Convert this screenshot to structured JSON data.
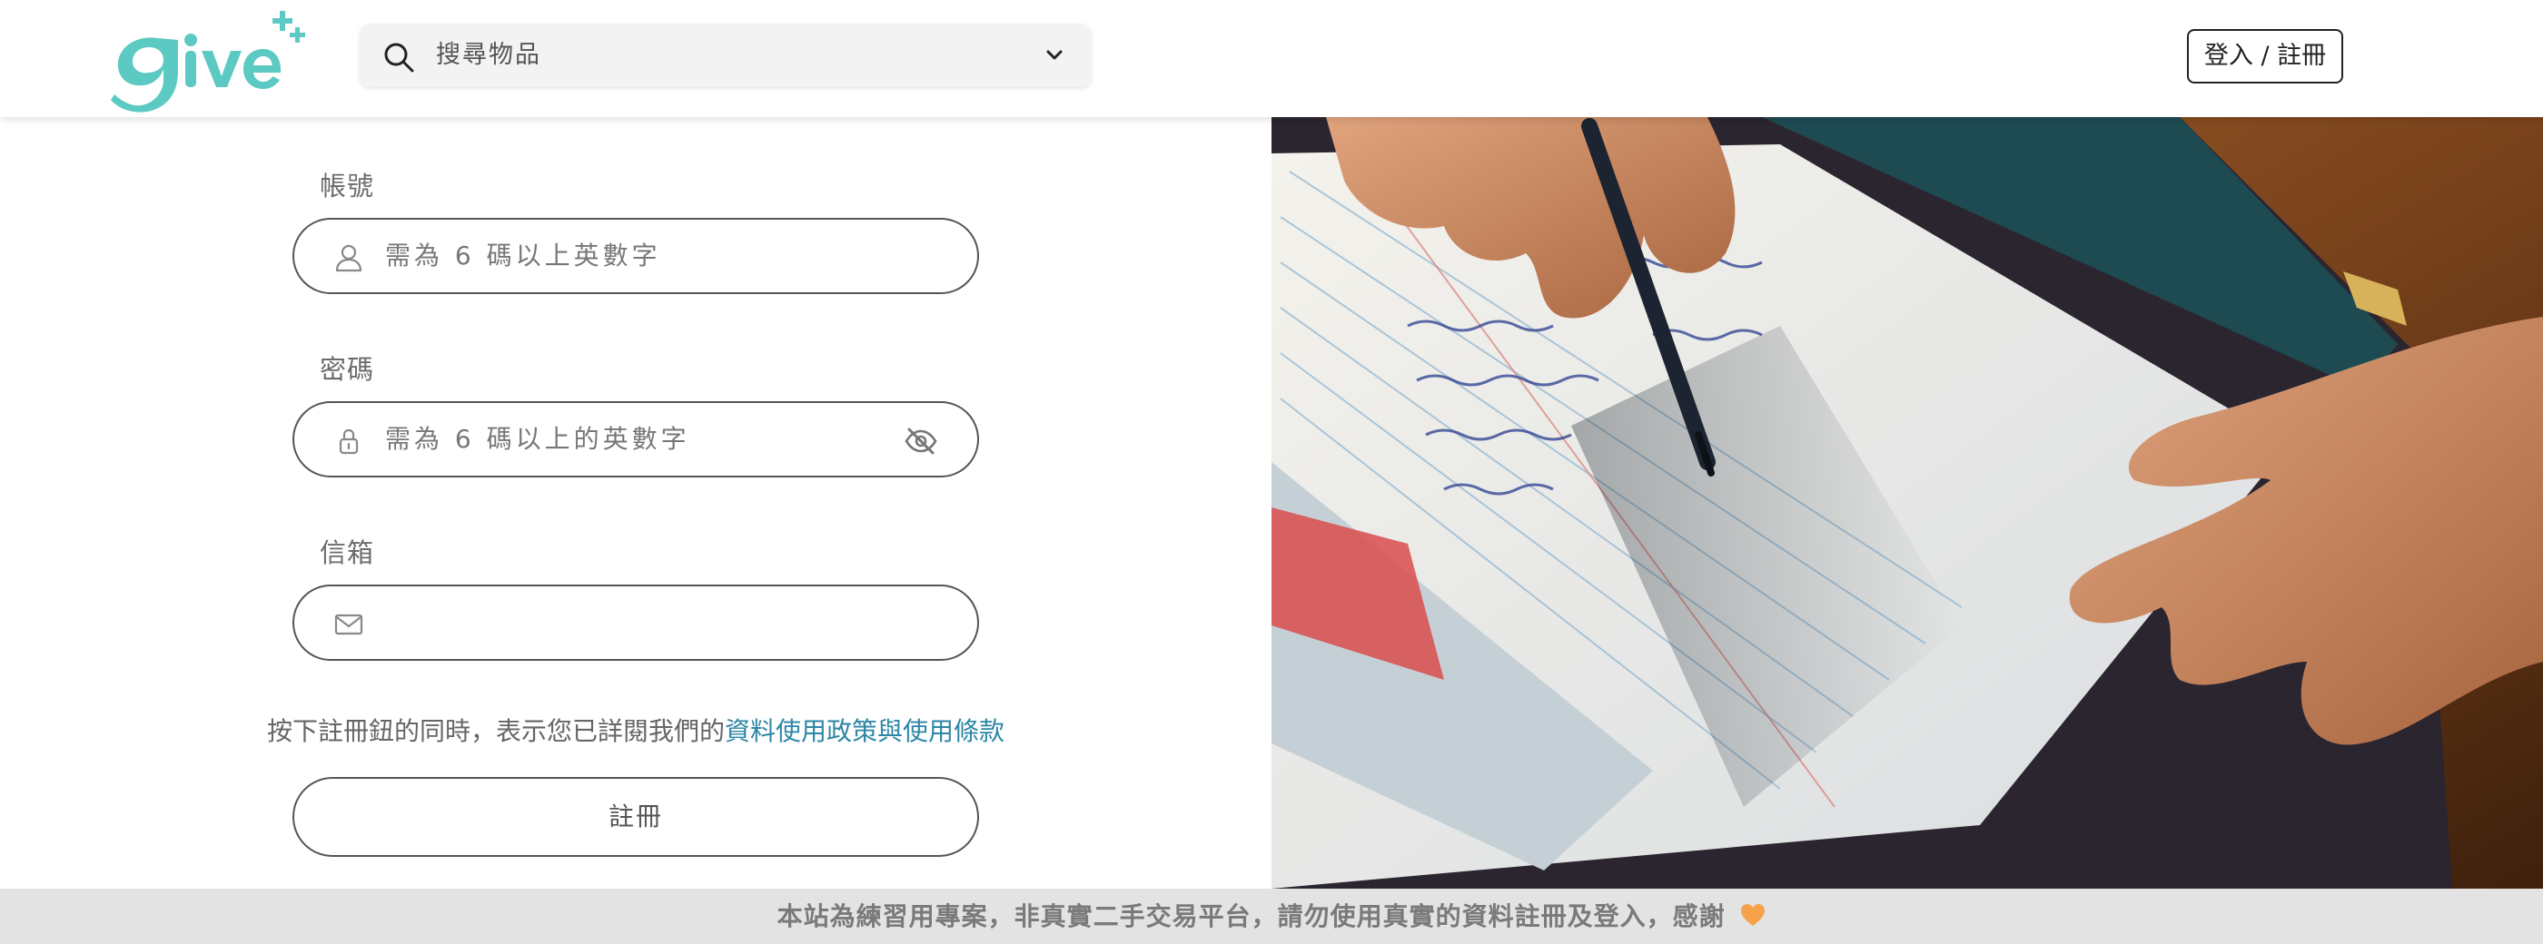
{
  "header": {
    "logo_text": "give+",
    "search": {
      "placeholder": "搜尋物品",
      "icon": "search-icon",
      "dropdown_icon": "chevron-down-icon"
    },
    "login_label": "登入 / 註冊"
  },
  "form": {
    "account": {
      "label": "帳號",
      "placeholder": "需為 6 碼以上英數字",
      "icon": "user-icon"
    },
    "password": {
      "label": "密碼",
      "placeholder": "需為 6 碼以上的英數字",
      "icon": "lock-icon",
      "toggle_icon": "eye-off-icon"
    },
    "email": {
      "label": "信箱",
      "placeholder": "",
      "icon": "mail-icon"
    },
    "terms_prefix": "按下註冊鈕的同時，表示您已詳閱我們的",
    "terms_link": "資料使用政策與使用條款",
    "register_label": "註冊"
  },
  "banner": {
    "text": "本站為練習用專案，非真實二手交易平台，請勿使用真實的資料註冊及登入，感謝",
    "icon": "orange-heart-icon"
  },
  "colors": {
    "brand_teal": "#5cc9c3",
    "link": "#2d86a6",
    "heart": "#f7a14a",
    "banner_bg": "#e4e3e4"
  }
}
